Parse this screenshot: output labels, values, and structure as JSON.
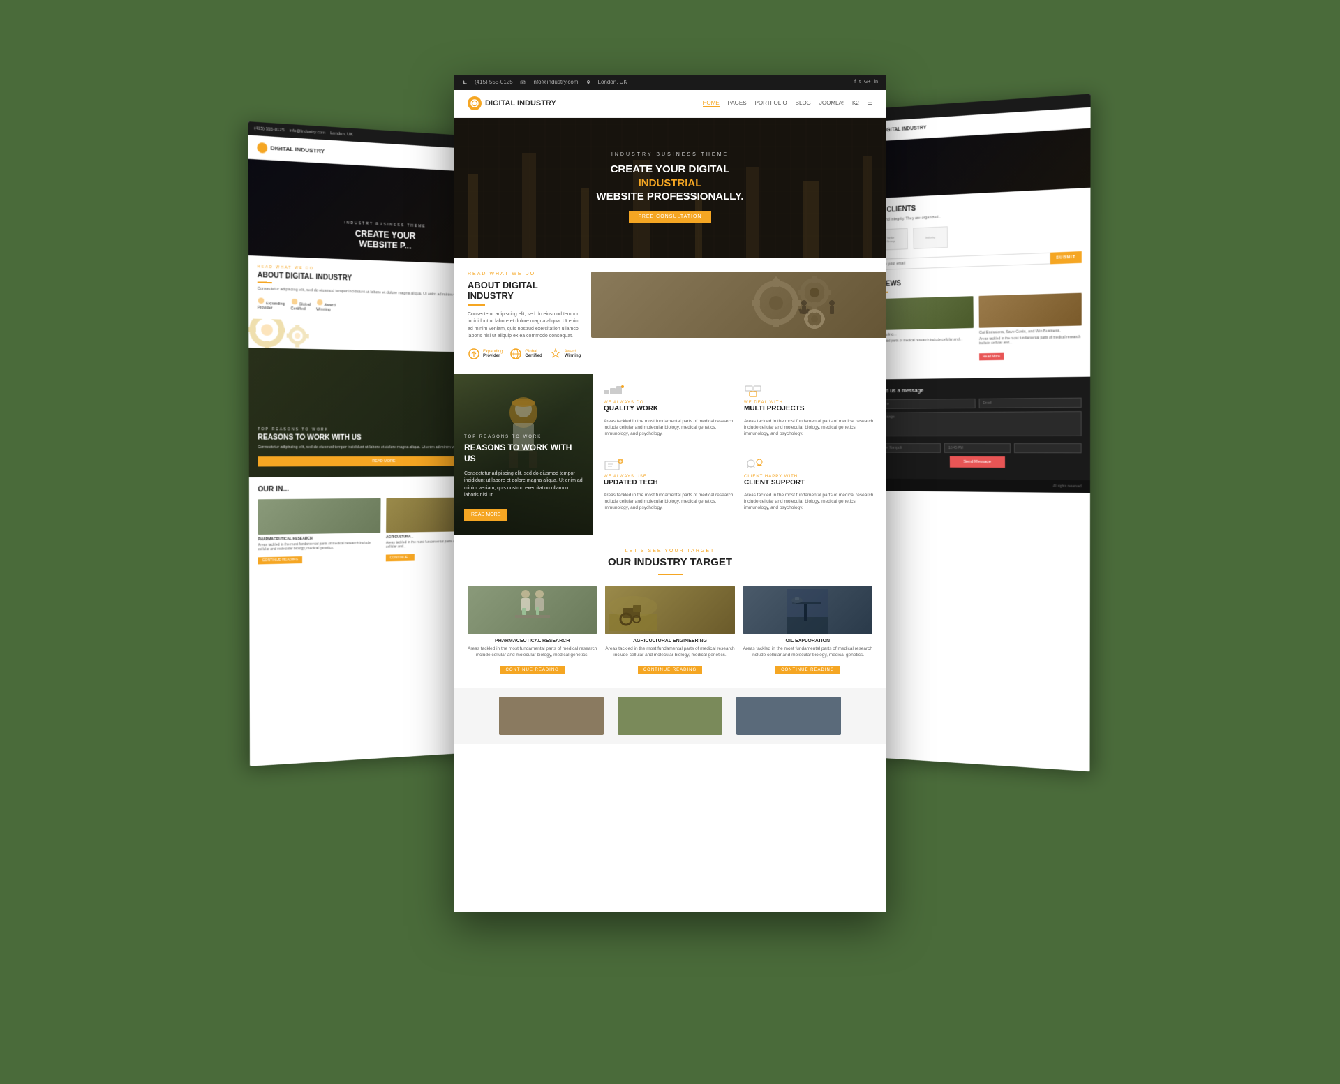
{
  "brand": {
    "name": "DIGITAL INDUSTRY",
    "tagline": "INDUSTRY BUSINESS THEME"
  },
  "topbar": {
    "phone": "(415) 555-0125",
    "email": "info@industry.com",
    "location": "London, UK"
  },
  "nav": {
    "links": [
      "HOME",
      "PAGES",
      "PORTFOLIO",
      "BLOG",
      "JOOMLA!",
      "K2",
      "☰"
    ],
    "active": "HOME"
  },
  "hero": {
    "subtitle": "INDUSTRY BUSINESS THEME",
    "title_line1": "CREATE YOUR DIGITAL",
    "title_highlight": "INDUSTRIAL",
    "title_line2": "WEBSITE PROFESSIONALLY.",
    "cta": "FREE CONSULTATION"
  },
  "about": {
    "eyebrow": "READ WHAT WE DO",
    "title": "ABOUT DIGITAL INDUSTRY",
    "text": "Consectetur adipiscing elit, sed do eiusmod tempor incididunt ut labore et dolore magna aliqua. Ut enim ad minim veniam, quis nostrud exercitation ullamco laboris nisi ut aliquip ex ea commodo consequat.",
    "stats": [
      {
        "icon": "trophy-icon",
        "label": "Expanding",
        "sublabel": "Provider"
      },
      {
        "icon": "globe-icon",
        "label": "Global",
        "sublabel": "Certified"
      },
      {
        "icon": "award-icon",
        "label": "Award",
        "sublabel": "Winning"
      }
    ]
  },
  "reasons": {
    "eyebrow": "TOP REASONS TO WORK",
    "title": "REASONS TO WORK WITH US",
    "text": "Consectetur adipiscing elit, sed do eiusmod tempor incididunt ut labore et dolore magna aliqua. Ut enim ad minim veniam, quis nostrud exercitation ullamco laboris nisi ut...",
    "cta": "READ MORE",
    "items": [
      {
        "eyebrow": "WE ALWAYS DO",
        "title": "QUALITY WORK",
        "text": "Areas tackled in the most fundamental parts of medical research include cellular and molecular biology, medical genetics, immunology, and psychology."
      },
      {
        "eyebrow": "WE DEAL WITH",
        "title": "MULTI PROJECTS",
        "text": "Areas tackled in the most fundamental parts of medical research include cellular and molecular biology, medical genetics, immunology, and psychology."
      },
      {
        "eyebrow": "WE ALWAYS USE",
        "title": "UPDATED TECH",
        "text": "Areas tackled in the most fundamental parts of medical research include cellular and molecular biology, medical genetics, immunology, and psychology."
      },
      {
        "eyebrow": "CLIENT HAPPY WITH",
        "title": "CLIENT SUPPORT",
        "text": "Areas tackled in the most fundamental parts of medical research include cellular and molecular biology, medical genetics, immunology, and psychology."
      }
    ]
  },
  "target": {
    "eyebrow": "LET'S SEE YOUR TARGET",
    "title": "OUR INDUSTRY TARGET",
    "items": [
      {
        "label": "PHARMACEUTICAL RESEARCH",
        "text": "Areas tackled in the most fundamental parts of medical research include cellular and molecular biology, medical genetics.",
        "cta": "CONTINUE READING"
      },
      {
        "label": "AGRICULTURAL ENGINEERING",
        "text": "Areas tackled in the most fundamental parts of medical research include cellular and molecular biology, medical genetics.",
        "cta": "CONTINUE READING"
      },
      {
        "label": "OIL EXPLORATION",
        "text": "Areas tackled in the most fundamental parts of medical research include cellular and molecular biology, medical genetics.",
        "cta": "CONTINUE READING"
      }
    ]
  },
  "left_hero": {
    "subtitle": "INDUSTRY",
    "title_lines": [
      "CREATE YOUR",
      "WEBSITE P..."
    ]
  },
  "left_about": {
    "eyebrow": "READ WHAT WE DO",
    "title": "ABOUT DIGITAL INDUSTRY",
    "text": "Consectetur adipiscing elit, sed do eiusmod tempor incididunt ut labore et dolore magna aliqua. Ut enim ad minim veniam."
  },
  "left_reasons": {
    "eyebrow": "TOP REASONS TO WORK",
    "title": "REASONS TO WORK WITH US",
    "text": "Consectetur adipiscing elit, sed do eiusmod tempor incididunt ut labore et dolore magna aliqua. Ut enim ad minim veniam, quis nostrud.",
    "cta": "READ MORE"
  },
  "left_industry": {
    "title": "OUR IN...",
    "items": [
      {
        "label": "PHARMACEUTICAL RESEARCH",
        "text": "Areas tackled in the most fundamental parts of medical research include cellular and molecular biology, medical genetics."
      },
      {
        "label": "AGRICULTURA...",
        "text": "Areas tackled in the most fundamental parts of medical research include cellular and..."
      }
    ]
  },
  "right": {
    "clients_title": "S & CLIENTS",
    "clients_text": "...ism and integrity. They are organized...",
    "email_placeholder": "Type your email",
    "email_btn": "SUBMIT",
    "news_title": "Y NEWS",
    "news_items": [
      {
        "caption": "Scheduling...",
        "text": "...amental parts of medical research include cellular and..."
      },
      {
        "caption": "Cut Emissions, Save Costs, and Win Business.",
        "text": "Areas tackled in the most fundamental parts of medical research include cellular and..."
      }
    ],
    "news_btn": "Read More",
    "contact": {
      "title": "Send us a message",
      "fields": [
        "omer Nampoli US.",
        "Name",
        "Email",
        "Message",
        "10:45 PM"
      ],
      "send_btn": "Send Message",
      "footer": "All rights reserved"
    }
  },
  "colors": {
    "accent": "#f5a623",
    "dark": "#1a1a1a",
    "error": "#e85555",
    "text": "#333333",
    "muted": "#666666"
  }
}
